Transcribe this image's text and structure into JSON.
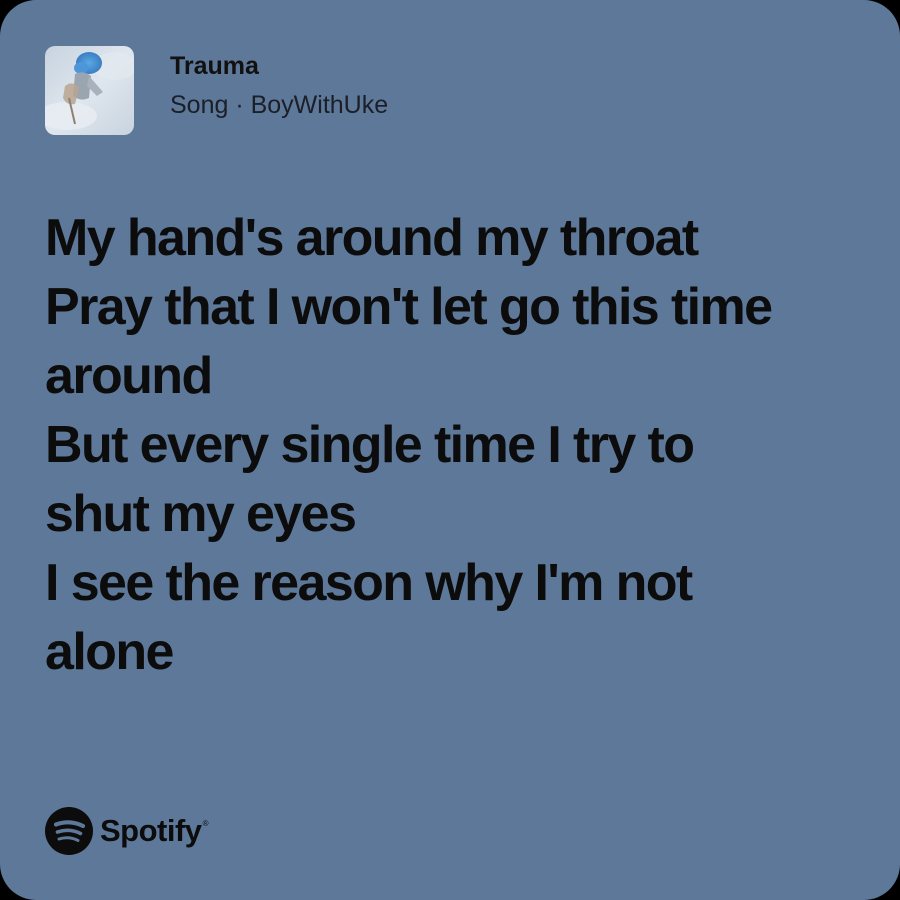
{
  "song": {
    "title": "Trauma",
    "subtitle": "Song · BoyWithUke",
    "cover_icon": "album-cover-image"
  },
  "lyrics": [
    "My hand's around my throat",
    "Pray that I won't let go this time",
    "around",
    "But every single time I try to",
    "shut my eyes",
    "I see the reason why I'm not",
    "alone"
  ],
  "brand": {
    "name": "Spotify",
    "registered_mark": "®",
    "icon": "spotify-logo-icon"
  },
  "colors": {
    "card_background": "#5e7899",
    "text": "#0c0c0c"
  }
}
